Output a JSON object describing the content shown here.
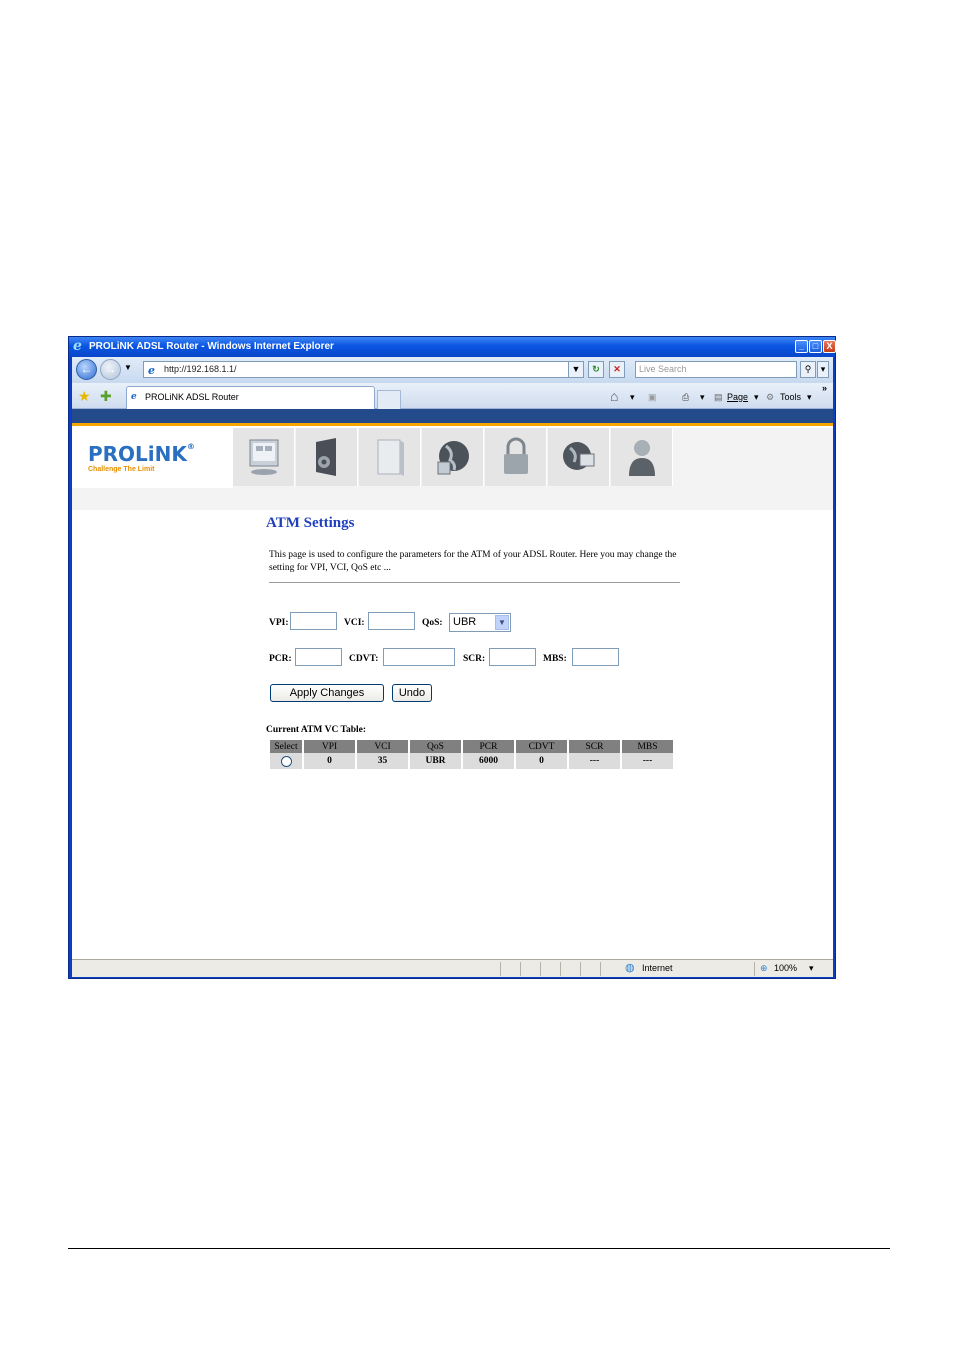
{
  "window": {
    "title": "PROLiNK ADSL Router - Windows Internet Explorer",
    "minimize": "_",
    "maximize": "□",
    "close": "X"
  },
  "navbar": {
    "back_glyph": "←",
    "forward_glyph": "→",
    "address": "http://192.168.1.1/",
    "search_placeholder": "Live Search"
  },
  "tabs": {
    "active_label": "PROLiNK ADSL Router"
  },
  "command_bar": {
    "page_label": "Page",
    "tools_label": "Tools",
    "more": "»"
  },
  "brand": {
    "name": "PROLiNK",
    "registered": "®",
    "tagline": "Challenge The Limit"
  },
  "nav_icons": [
    "status-icon",
    "setup-icon",
    "device-icon",
    "internet-globe-icon",
    "security-lock-icon",
    "network-globe-icon",
    "admin-user-icon"
  ],
  "page": {
    "title": "ATM Settings",
    "description": "This page is used to configure the parameters for the ATM of your ADSL Router. Here you may change the setting for VPI, VCI, QoS etc ..."
  },
  "form": {
    "vpi_label": "VPI:",
    "vci_label": "VCI:",
    "qos_label": "QoS:",
    "qos_value": "UBR",
    "pcr_label": "PCR:",
    "cdvt_label": "CDVT:",
    "scr_label": "SCR:",
    "mbs_label": "MBS:",
    "apply_label": "Apply Changes",
    "undo_label": "Undo"
  },
  "vc_table": {
    "caption": "Current ATM VC Table:",
    "headers": [
      "Select",
      "VPI",
      "VCI",
      "QoS",
      "PCR",
      "CDVT",
      "SCR",
      "MBS"
    ],
    "rows": [
      {
        "vpi": "0",
        "vci": "35",
        "qos": "UBR",
        "pcr": "6000",
        "cdvt": "0",
        "scr": "---",
        "mbs": "---"
      }
    ]
  },
  "statusbar": {
    "zone": "Internet",
    "zoom": "100%"
  },
  "colors": {
    "title_blue": "#1f3fbf",
    "stripe_blue": "#234b8b",
    "stripe_orange": "#f5a500",
    "brand_blue": "#2a6fc0"
  }
}
